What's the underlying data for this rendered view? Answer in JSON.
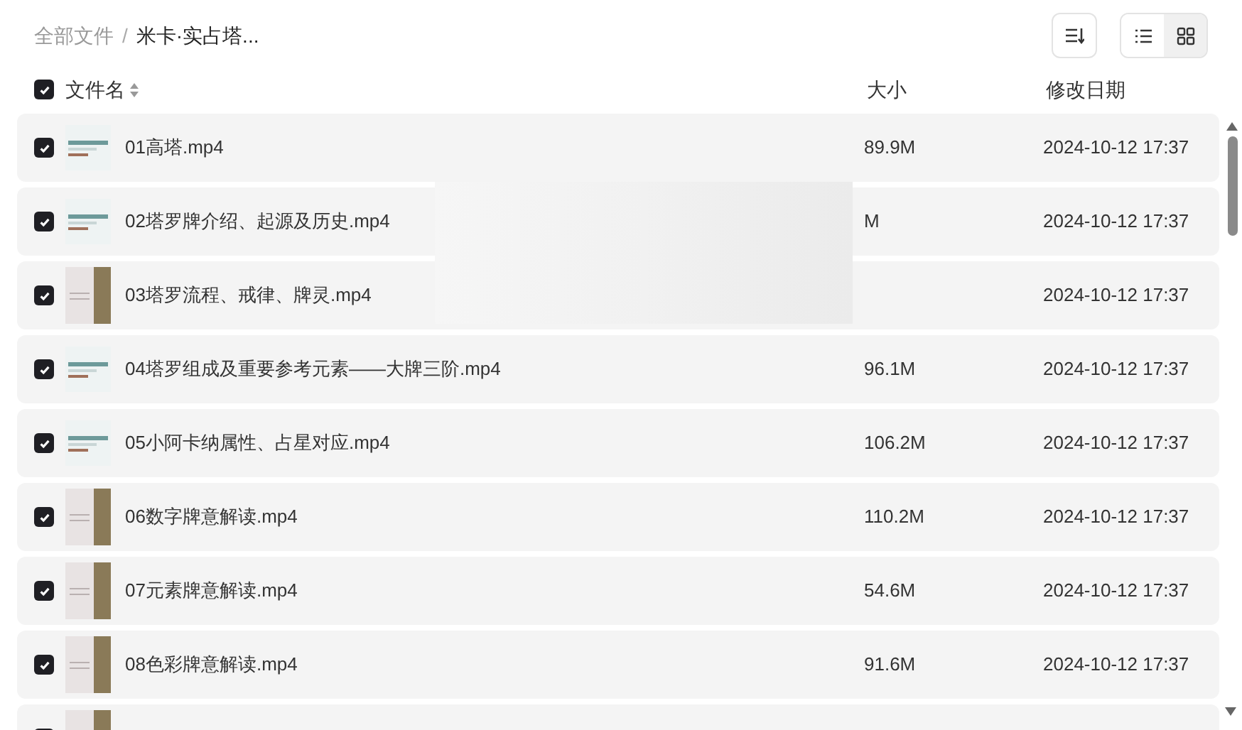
{
  "breadcrumb_separator": "/",
  "breadcrumb": [
    {
      "label": "全部文件"
    },
    {
      "label": "米卡·实占塔..."
    }
  ],
  "view_modes": [
    {
      "kind": "list",
      "selected": false
    },
    {
      "kind": "grid",
      "selected": true
    }
  ],
  "header": {
    "checked": true,
    "name": "文件名",
    "size": "大小",
    "date": "修改日期"
  },
  "files": [
    {
      "checked": true,
      "name": "01高塔.mp4",
      "size": "89.9M",
      "date": "2024-10-12 17:37",
      "kind": "doc"
    },
    {
      "checked": true,
      "name": "02塔罗牌介绍、起源及历史.mp4",
      "size": "M",
      "date": "2024-10-12 17:37",
      "kind": "doc"
    },
    {
      "checked": true,
      "name": "03塔罗流程、戒律、牌灵.mp4",
      "date": "2024-10-12 17:37",
      "kind": "card"
    },
    {
      "checked": true,
      "name": "04塔罗组成及重要参考元素——大牌三阶.mp4",
      "size": "96.1M",
      "date": "2024-10-12 17:37",
      "kind": "doc"
    },
    {
      "checked": true,
      "name": "05小阿卡纳属性、占星对应.mp4",
      "size": "106.2M",
      "date": "2024-10-12 17:37",
      "kind": "doc"
    },
    {
      "checked": true,
      "name": "06数字牌意解读.mp4",
      "size": "110.2M",
      "date": "2024-10-12 17:37",
      "kind": "card"
    },
    {
      "checked": true,
      "name": "07元素牌意解读.mp4",
      "size": "54.6M",
      "date": "2024-10-12 17:37",
      "kind": "card"
    },
    {
      "checked": true,
      "name": "08色彩牌意解读.mp4",
      "size": "91.6M",
      "date": "2024-10-12 17:37",
      "kind": "card"
    },
    {
      "checked": true,
      "kind": "card"
    }
  ]
}
